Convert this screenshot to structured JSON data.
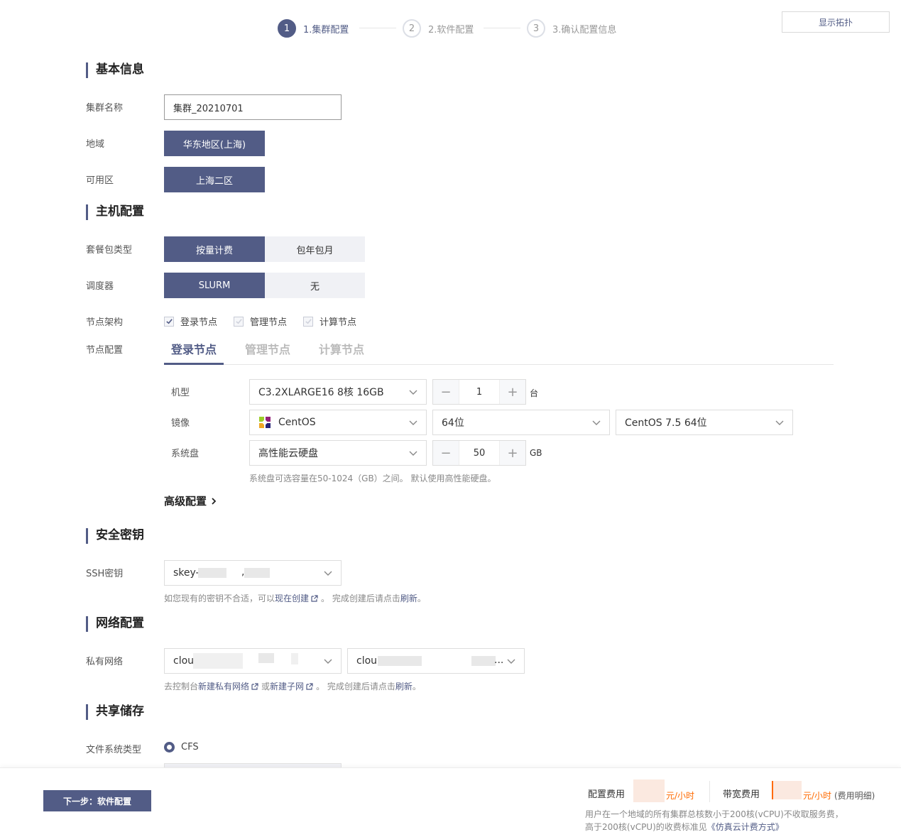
{
  "steps": [
    {
      "num": "1",
      "label": "1.集群配置"
    },
    {
      "num": "2",
      "label": "2.软件配置"
    },
    {
      "num": "3",
      "label": "3.确认配置信息"
    }
  ],
  "topology_button": "显示拓扑",
  "basic": {
    "title": "基本信息",
    "cluster_name_label": "集群名称",
    "cluster_name_value": "集群_20210701",
    "region_label": "地域",
    "region_value": "华东地区(上海)",
    "zone_label": "可用区",
    "zone_value": "上海二区"
  },
  "host": {
    "title": "主机配置",
    "package_label": "套餐包类型",
    "package_options": [
      "按量计费",
      "包年包月"
    ],
    "scheduler_label": "调度器",
    "scheduler_options": [
      "SLURM",
      "无"
    ],
    "arch_label": "节点架构",
    "arch_options": [
      "登录节点",
      "管理节点",
      "计算节点"
    ],
    "node_config_label": "节点配置",
    "tabs": [
      "登录节点",
      "管理节点",
      "计算节点"
    ],
    "model_label": "机型",
    "model_value": "C3.2XLARGE16 8核 16GB",
    "count_value": "1",
    "count_unit": "台",
    "image_label": "镜像",
    "image_value": "CentOS",
    "image_bits": "64位",
    "image_version": "CentOS 7.5 64位",
    "disk_label": "系统盘",
    "disk_value": "高性能云硬盘",
    "disk_size": "50",
    "disk_unit": "GB",
    "disk_hint": "系统盘可选容量在50-1024（GB）之间。 默认使用高性能硬盘。",
    "advanced": "高级配置"
  },
  "security": {
    "title": "安全密钥",
    "ssh_label": "SSH密钥",
    "ssh_value": "skey-",
    "ssh_value_tail": ",",
    "hint_pre": "如您现有的密钥不合适，可以",
    "hint_link": "现在创建",
    "hint_mid": "。 完成创建后请点击",
    "hint_refresh": "刷新",
    "hint_end": "。"
  },
  "network": {
    "title": "网络配置",
    "vpc_label": "私有网络",
    "vpc_value": "clou",
    "subnet_value": "clou",
    "subnet_tail": "...",
    "hint_pre": "去控制台",
    "hint_link1": "新建私有网络",
    "hint_or": "或",
    "hint_link2": "新建子网",
    "hint_mid": "。 完成创建后请点击",
    "hint_refresh": "刷新",
    "hint_end": "。"
  },
  "storage": {
    "title": "共享储存",
    "fs_label": "文件系统类型",
    "fs_value": "CFS"
  },
  "footer": {
    "next_button": "下一步：软件配置",
    "config_fee_label": "配置费用",
    "config_fee_unit": "元/小时",
    "bandwidth_fee_label": "带宽费用",
    "bandwidth_fee_unit": "元/小时",
    "fee_detail": "(费用明细)",
    "note_line1": "用户在一个地域的所有集群总核数小于200核(vCPU)不收取服务费，",
    "note_line2_pre": "高于200核(vCPU)的收费标准见",
    "note_line2_link": "《仿真云计费方式》"
  },
  "colors": {
    "accent": "#525c86",
    "fee": "#ff6a00"
  }
}
